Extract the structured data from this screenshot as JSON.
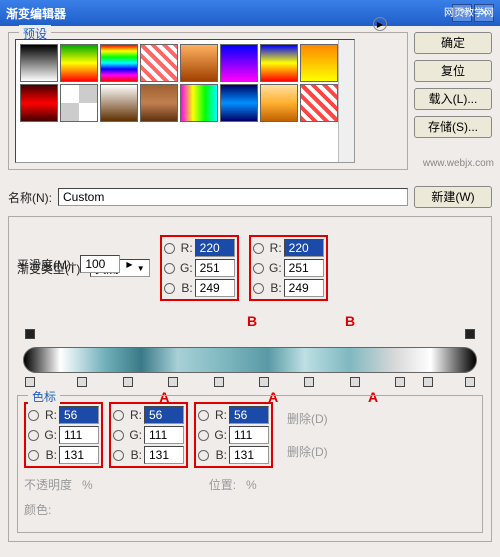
{
  "title": "渐变编辑器",
  "watermark": "网页教学网",
  "watermark2": "www.webjx.com",
  "presets_label": "预设",
  "buttons": {
    "ok": "确定",
    "reset": "复位",
    "load": "载入(L)...",
    "save": "存储(S)...",
    "new": "新建(W)"
  },
  "name_label": "名称(N):",
  "name_value": "Custom",
  "grad_type_label": "渐变类型(T):",
  "grad_type_value": "实底",
  "smooth_label": "平滑度(M):",
  "smooth_value": "100",
  "marker_A": "A",
  "marker_B": "B",
  "stops_label": "色标",
  "opacity_label": "不透明度",
  "color_label": "颜色:",
  "position_label": "位置:",
  "delete_label": "删除(D)",
  "percent": "%",
  "rgb_labels": {
    "r": "R:",
    "g": "G:",
    "b": "B:"
  },
  "B_col": {
    "r": "220",
    "g": "251",
    "b": "249"
  },
  "A_col": {
    "r": "56",
    "g": "111",
    "b": "131"
  },
  "swatches": [
    "linear-gradient(#000,#fff)",
    "linear-gradient(#0a0,#ff0,#f00)",
    "linear-gradient(#f00,#ff0,#0f0,#0ff,#00f,#f0f,#f00)",
    "repeating-linear-gradient(45deg,#f66,#f66 4px,#fff 4px,#fff 8px)",
    "linear-gradient(#ffb060,#a04000)",
    "linear-gradient(#00f,#f0f)",
    "linear-gradient(#00f,#ff0,#f00)",
    "linear-gradient(#f80,#ff0)",
    "linear-gradient(#400,#f00,#400)",
    "repeating-conic-gradient(#ccc 0 25%,#fff 0 50%)",
    "linear-gradient(#fff,#603000)",
    "linear-gradient(#a06030,#c08050,#603010)",
    "linear-gradient(to right,#f0f,#ff0,#0f0,#0ff)",
    "linear-gradient(#006,#0090ff,#006)",
    "linear-gradient(#ffe0a0,#ffb030,#c06000)",
    "repeating-linear-gradient(45deg,#f44,#f44 4px,#fff 4px,#fff 8px)"
  ]
}
